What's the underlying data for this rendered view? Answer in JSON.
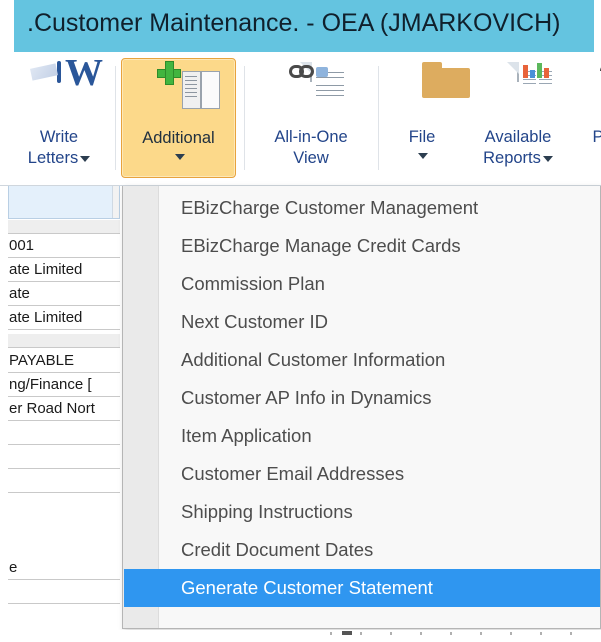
{
  "window": {
    "title": ".Customer Maintenance.  -  OEA (JMARKOVICH)"
  },
  "ribbon": {
    "buttons": [
      {
        "label_line1": "Write",
        "label_line2": "Letters",
        "icon": "word-document-icon",
        "has_caret": true,
        "caret_inline": true,
        "active": false
      },
      {
        "label_line1": "Additional",
        "label_line2": "",
        "icon": "book-plus-icon",
        "has_caret": true,
        "caret_inline": false,
        "active": true
      },
      {
        "label_line1": "All-in-One",
        "label_line2": "View",
        "icon": "document-link-icon",
        "has_caret": false,
        "caret_inline": false,
        "active": false
      },
      {
        "label_line1": "File",
        "label_line2": "",
        "icon": "folder-icon",
        "has_caret": true,
        "caret_inline": false,
        "active": false
      },
      {
        "label_line1": "Available",
        "label_line2": "Reports",
        "icon": "report-chart-icon",
        "has_caret": true,
        "caret_inline": true,
        "active": false
      },
      {
        "label_line1": "P",
        "label_line2": "",
        "icon": "eye-preview-icon",
        "has_caret": false,
        "caret_inline": false,
        "active": false
      }
    ]
  },
  "form_fields": [
    {
      "value": "001"
    },
    {
      "value": "ate Limited"
    },
    {
      "value": "ate"
    },
    {
      "value": "ate Limited"
    },
    {
      "value": "PAYABLE"
    },
    {
      "value": "ng/Finance ["
    },
    {
      "value": "er Road Nort"
    },
    {
      "value": ""
    },
    {
      "value": ""
    },
    {
      "value": "e"
    }
  ],
  "menu": {
    "items": [
      {
        "label": "EBizCharge Customer Management",
        "selected": false
      },
      {
        "label": "EBizCharge Manage Credit Cards",
        "selected": false
      },
      {
        "label": "Commission Plan",
        "selected": false
      },
      {
        "label": "Next Customer ID",
        "selected": false
      },
      {
        "label": "Additional Customer Information",
        "selected": false
      },
      {
        "label": "Customer AP Info in Dynamics",
        "selected": false
      },
      {
        "label": "Item Application",
        "selected": false
      },
      {
        "label": "Customer Email Addresses",
        "selected": false
      },
      {
        "label": "Shipping Instructions",
        "selected": false
      },
      {
        "label": "Credit Document Dates",
        "selected": false
      },
      {
        "label": "Generate Customer Statement",
        "selected": true
      }
    ]
  },
  "colors": {
    "titlebar": "#64c4e0",
    "active_button": "#fcd98a",
    "active_button_border": "#e8a33d",
    "menu_highlight": "#2f96f0",
    "menu_text": "#4d4d4d",
    "ribbon_label": "#23458a"
  }
}
